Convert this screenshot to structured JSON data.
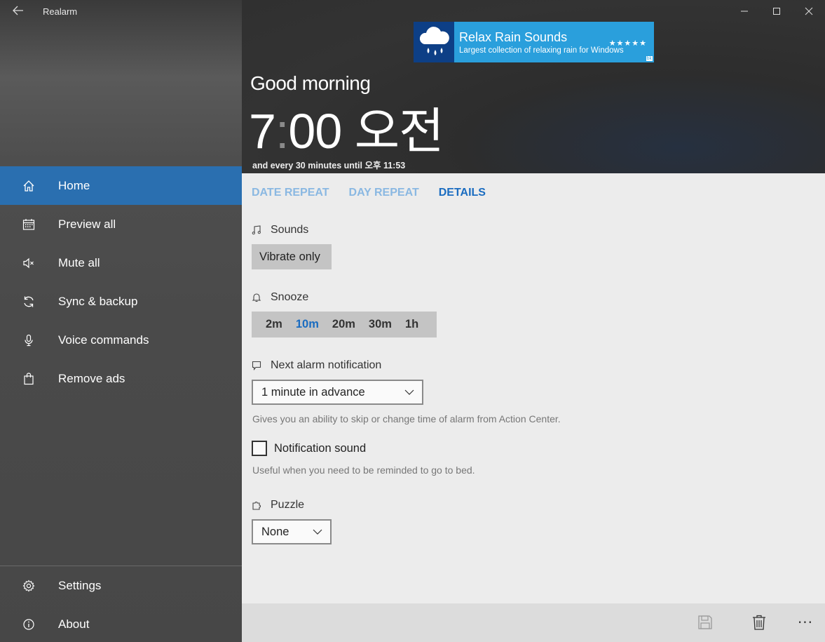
{
  "window": {
    "title": "Realarm"
  },
  "sidebar": {
    "items": [
      {
        "label": "Home",
        "icon": "home-icon",
        "active": true
      },
      {
        "label": "Preview all",
        "icon": "calendar-icon"
      },
      {
        "label": "Mute all",
        "icon": "mute-icon"
      },
      {
        "label": "Sync & backup",
        "icon": "sync-icon"
      },
      {
        "label": "Voice commands",
        "icon": "microphone-icon"
      },
      {
        "label": "Remove ads",
        "icon": "shopping-bag-icon"
      }
    ],
    "bottom_items": [
      {
        "label": "Settings",
        "icon": "gear-icon"
      },
      {
        "label": "About",
        "icon": "info-icon"
      }
    ]
  },
  "ad": {
    "title": "Relax Rain Sounds",
    "subtitle": "Largest collection of relaxing rain for Windows",
    "stars": "★★★★★",
    "badge": "bk"
  },
  "header": {
    "greeting": "Good morning",
    "hour": "7",
    "colon": ":",
    "minutes": "00",
    "period": "오전",
    "repeat_info": "and every 30 minutes until 오후 11:53"
  },
  "tabs": [
    "DATE REPEAT",
    "DAY REPEAT",
    "DETAILS"
  ],
  "details": {
    "sounds_label": "Sounds",
    "sounds_value": "Vibrate only",
    "snooze_label": "Snooze",
    "snooze_options": [
      "2m",
      "10m",
      "20m",
      "30m",
      "1h"
    ],
    "snooze_selected": "10m",
    "next_notification_label": "Next alarm notification",
    "next_notification_value": "1 minute in advance",
    "next_notification_help": "Gives you an ability to skip or change time of alarm from Action Center.",
    "notification_sound_label": "Notification sound",
    "notification_sound_checked": false,
    "notification_sound_help": "Useful when you need to be reminded to go to bed.",
    "puzzle_label": "Puzzle",
    "puzzle_value": "None"
  },
  "colors": {
    "accent": "#2a6fb0",
    "tab_active": "#1a6cc0",
    "tab_inactive": "#8ab8e2",
    "ad_background": "#2a9fdc"
  },
  "commandbar": {
    "save_icon": "save-icon",
    "delete_icon": "trash-icon",
    "more_label": "···"
  }
}
